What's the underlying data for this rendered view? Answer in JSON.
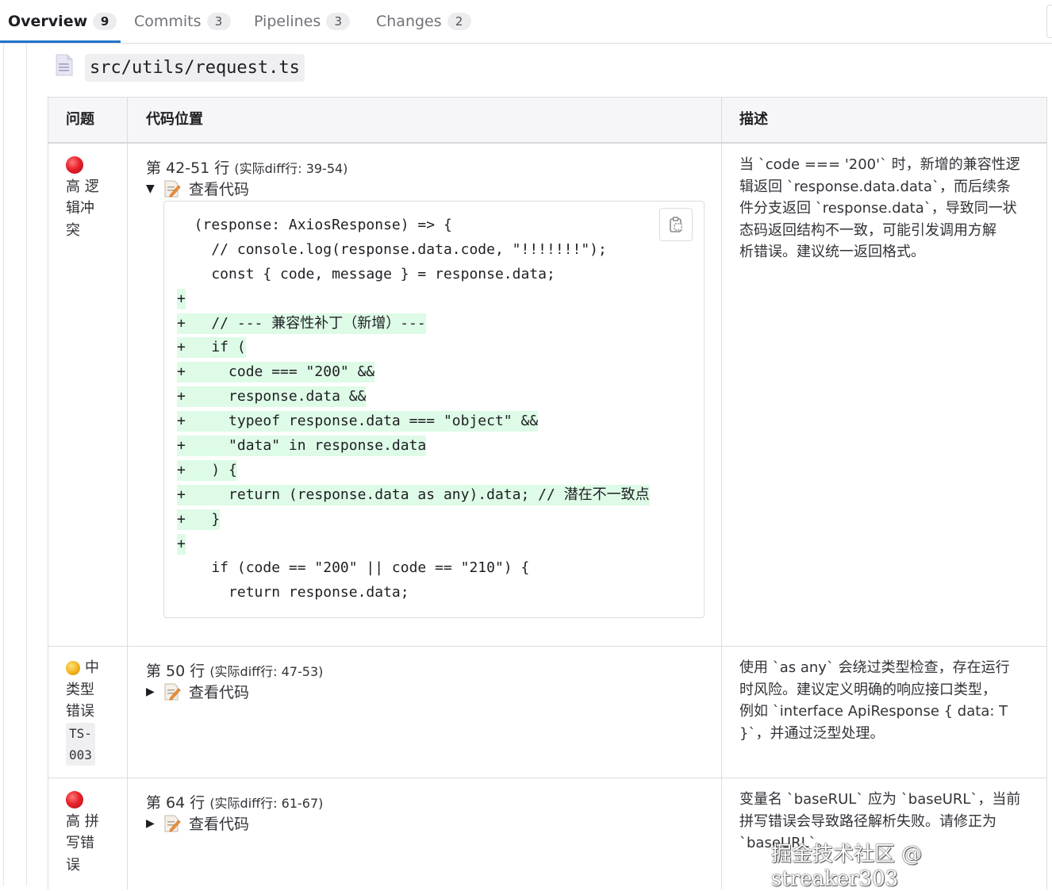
{
  "tabs": [
    {
      "label": "Overview",
      "count": "9",
      "active": true
    },
    {
      "label": "Commits",
      "count": "3",
      "active": false
    },
    {
      "label": "Pipelines",
      "count": "3",
      "active": false
    },
    {
      "label": "Changes",
      "count": "2",
      "active": false
    }
  ],
  "file": {
    "path": "src/utils/request.ts",
    "icon": "file-icon"
  },
  "table": {
    "headers": [
      "问题",
      "代码位置",
      "描述"
    ],
    "rows": [
      {
        "severity_icon": "red-circle-icon",
        "issue_lines": [
          "高 逻",
          "辑冲",
          "突"
        ],
        "location_main": "第 42-51 行",
        "location_diff": "(实际diff行: 39-54)",
        "toggle_icon": "triangle-down-icon",
        "view_label": "查看代码",
        "code_lines": [
          {
            "text": "  (response: AxiosResponse) => {",
            "added": false
          },
          {
            "text": "    // console.log(response.data.code, \"!!!!!!!\");",
            "added": false
          },
          {
            "text": "    const { code, message } = response.data;",
            "added": false
          },
          {
            "text": "+",
            "added": true
          },
          {
            "text": "+   // --- 兼容性补丁（新增）---",
            "added": true
          },
          {
            "text": "+   if (",
            "added": true
          },
          {
            "text": "+     code === \"200\" &&",
            "added": true
          },
          {
            "text": "+     response.data &&",
            "added": true
          },
          {
            "text": "+     typeof response.data === \"object\" &&",
            "added": true
          },
          {
            "text": "+     \"data\" in response.data",
            "added": true
          },
          {
            "text": "+   ) {",
            "added": true
          },
          {
            "text": "+     return (response.data as any).data; // 潜在不一致点",
            "added": true
          },
          {
            "text": "+   }",
            "added": true
          },
          {
            "text": "+",
            "added": true
          },
          {
            "text": "    if (code == \"200\" || code == \"210\") {",
            "added": false
          },
          {
            "text": "      return response.data;",
            "added": false
          }
        ],
        "description_lines": [
          "当 `code === '200'` 时，新增的兼容性逻",
          "辑返回 `response.data.data`，而后续条",
          "件分支返回 `response.data`，导致同一状",
          "态码返回结构不一致，可能引发调用方解",
          "析错误。建议统一返回格式。"
        ]
      },
      {
        "severity_icon": "yellow-circle-icon",
        "issue_first": "中",
        "issue_lines": [
          "类型",
          "错误"
        ],
        "issue_code": [
          "TS-",
          "003"
        ],
        "location_main": "第 50 行",
        "location_diff": "(实际diff行: 47-53)",
        "toggle_icon": "triangle-right-icon",
        "view_label": "查看代码",
        "description_lines": [
          "使用 `as any` 会绕过类型检查，存在运行",
          "时风险。建议定义明确的响应接口类型，",
          "例如 `interface ApiResponse { data: T",
          "}`，并通过泛型处理。"
        ]
      },
      {
        "severity_icon": "red-circle-icon",
        "issue_lines": [
          "高 拼",
          "写错",
          "误"
        ],
        "location_main": "第 64 行",
        "location_diff": "(实际diff行: 61-67)",
        "toggle_icon": "triangle-right-icon",
        "view_label": "查看代码",
        "description_lines": [
          "变量名 `baseRUL` 应为 `baseURL`，当前",
          "拼写错误会导致路径解析失败。请修正为",
          "`baseURL`。"
        ]
      }
    ]
  },
  "watermark": "掘金技术社区 @ streaker303"
}
